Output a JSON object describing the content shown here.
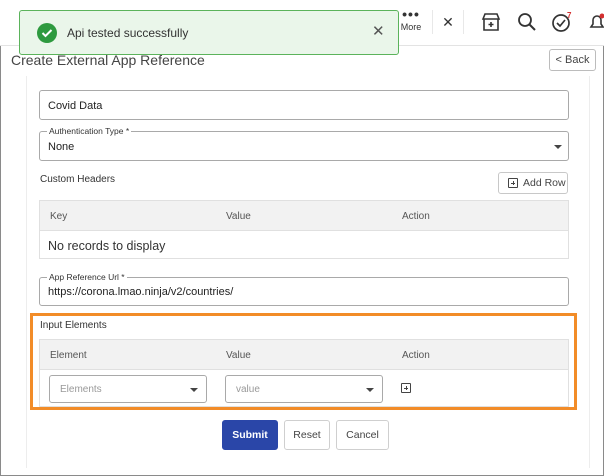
{
  "header": {
    "more_label": "More",
    "close_glyph": "✕",
    "icons": [
      "store-icon",
      "search-icon",
      "tasks-icon",
      "notifications-icon"
    ],
    "tasks_badge": "7"
  },
  "toast": {
    "message": "Api tested successfully",
    "close_glyph": "✕",
    "status_color": "#2e9a3f"
  },
  "page": {
    "title": "Create External App Reference",
    "back_label": "< Back"
  },
  "form": {
    "name_value": "Covid Data",
    "auth_type": {
      "label": "Authentication Type *",
      "value": "None"
    },
    "custom_headers": {
      "title": "Custom Headers",
      "add_row_label": "Add Row",
      "columns": [
        "Key",
        "Value",
        "Action"
      ],
      "empty_text": "No records to display"
    },
    "app_reference_url": {
      "label": "App Reference Url *",
      "value": "https://corona.lmao.ninja/v2/countries/"
    },
    "input_elements": {
      "title": "Input Elements",
      "columns": [
        "Element",
        "Value",
        "Action"
      ],
      "element_placeholder": "Elements",
      "value_placeholder": "value",
      "highlight_color": "#f28c28"
    }
  },
  "actions": {
    "submit": "Submit",
    "reset": "Reset",
    "cancel": "Cancel",
    "primary_color": "#2a46a8"
  }
}
